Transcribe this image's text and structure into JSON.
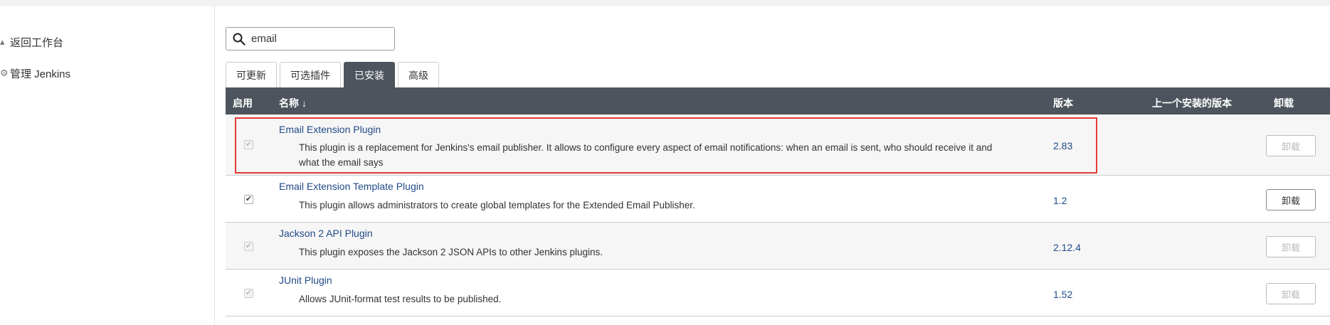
{
  "sidebar": {
    "back_label": "返回工作台",
    "manage_label": "管理 Jenkins"
  },
  "search": {
    "value": "email"
  },
  "tabs": [
    {
      "label": "可更新"
    },
    {
      "label": "可选插件"
    },
    {
      "label": "已安装"
    },
    {
      "label": "高级"
    }
  ],
  "active_tab": "已安装",
  "table": {
    "headers": {
      "enabled": "启用",
      "name": "名称 ↓",
      "version": "版本",
      "prev_version": "上一个安装的版本",
      "uninstall": "卸载"
    },
    "rows": [
      {
        "name": "Email Extension Plugin",
        "desc": "This plugin is a replacement for Jenkins's email publisher. It allows to configure every aspect of email notifications: when an email is sent, who should receive it and what the email says",
        "version": "2.83",
        "checked": true,
        "checkbox_disabled": true,
        "uninstall_label": "卸载",
        "uninstall_enabled": false
      },
      {
        "name": "Email Extension Template Plugin",
        "desc": "This plugin allows administrators to create global templates for the Extended Email Publisher.",
        "version": "1.2",
        "checked": true,
        "checkbox_disabled": false,
        "uninstall_label": "卸载",
        "uninstall_enabled": true
      },
      {
        "name": "Jackson 2 API Plugin",
        "desc": "This plugin exposes the Jackson 2 JSON APIs to other Jenkins plugins.",
        "version": "2.12.4",
        "checked": true,
        "checkbox_disabled": true,
        "uninstall_label": "卸载",
        "uninstall_enabled": false
      },
      {
        "name": "JUnit Plugin",
        "desc": "Allows JUnit-format test results to be published.",
        "version": "1.52",
        "checked": true,
        "checkbox_disabled": true,
        "uninstall_label": "卸载",
        "uninstall_enabled": false
      }
    ]
  },
  "colors": {
    "header_bg": "#4d545d",
    "link": "#204a87",
    "highlight": "#e53935"
  }
}
